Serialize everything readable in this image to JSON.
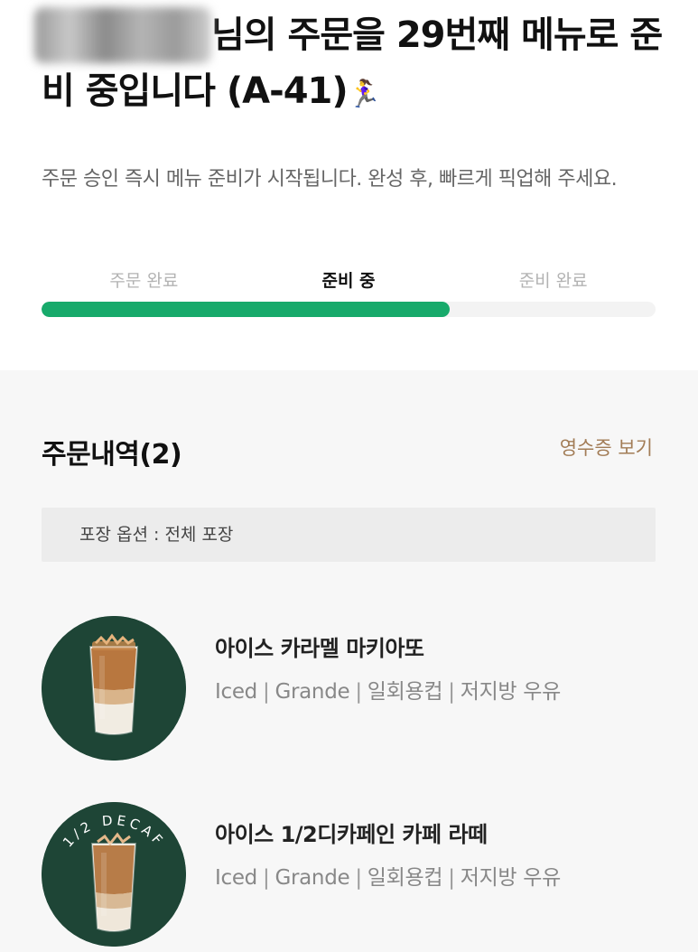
{
  "header": {
    "headline_part1": "님의 주문을 29번째 메뉴로 준비 중입니다 (A-41)",
    "runner_emoji": "🏃‍♀️",
    "subtitle": "주문 승인 즉시 메뉴 준비가 시작됩니다. 완성 후, 빠르게 픽업해 주세요."
  },
  "steps": [
    {
      "label": "주문 완료",
      "active": false
    },
    {
      "label": "준비 중",
      "active": true
    },
    {
      "label": "준비 완료",
      "active": false
    }
  ],
  "progress_fraction": 0.665,
  "colors": {
    "progress": "#17aa6b",
    "receipt_link": "#a27c56",
    "image_bg": "#1e4536"
  },
  "orders": {
    "title": "주문내역(2)",
    "receipt_link": "영수증 보기",
    "packaging": "포장 옵션 : 전체 포장",
    "items": [
      {
        "name": "아이스 카라멜 마키아또",
        "options": [
          "Iced",
          "Grande",
          "일회용컵",
          "저지방 우유"
        ],
        "image_icon": "iced-caramel-macchiato-image",
        "decaf_text": ""
      },
      {
        "name": "아이스 1/2디카페인 카페 라떼",
        "options": [
          "Iced",
          "Grande",
          "일회용컵",
          "저지방 우유"
        ],
        "image_icon": "iced-half-decaf-latte-image",
        "decaf_text": "1/2 DECAF"
      }
    ]
  }
}
